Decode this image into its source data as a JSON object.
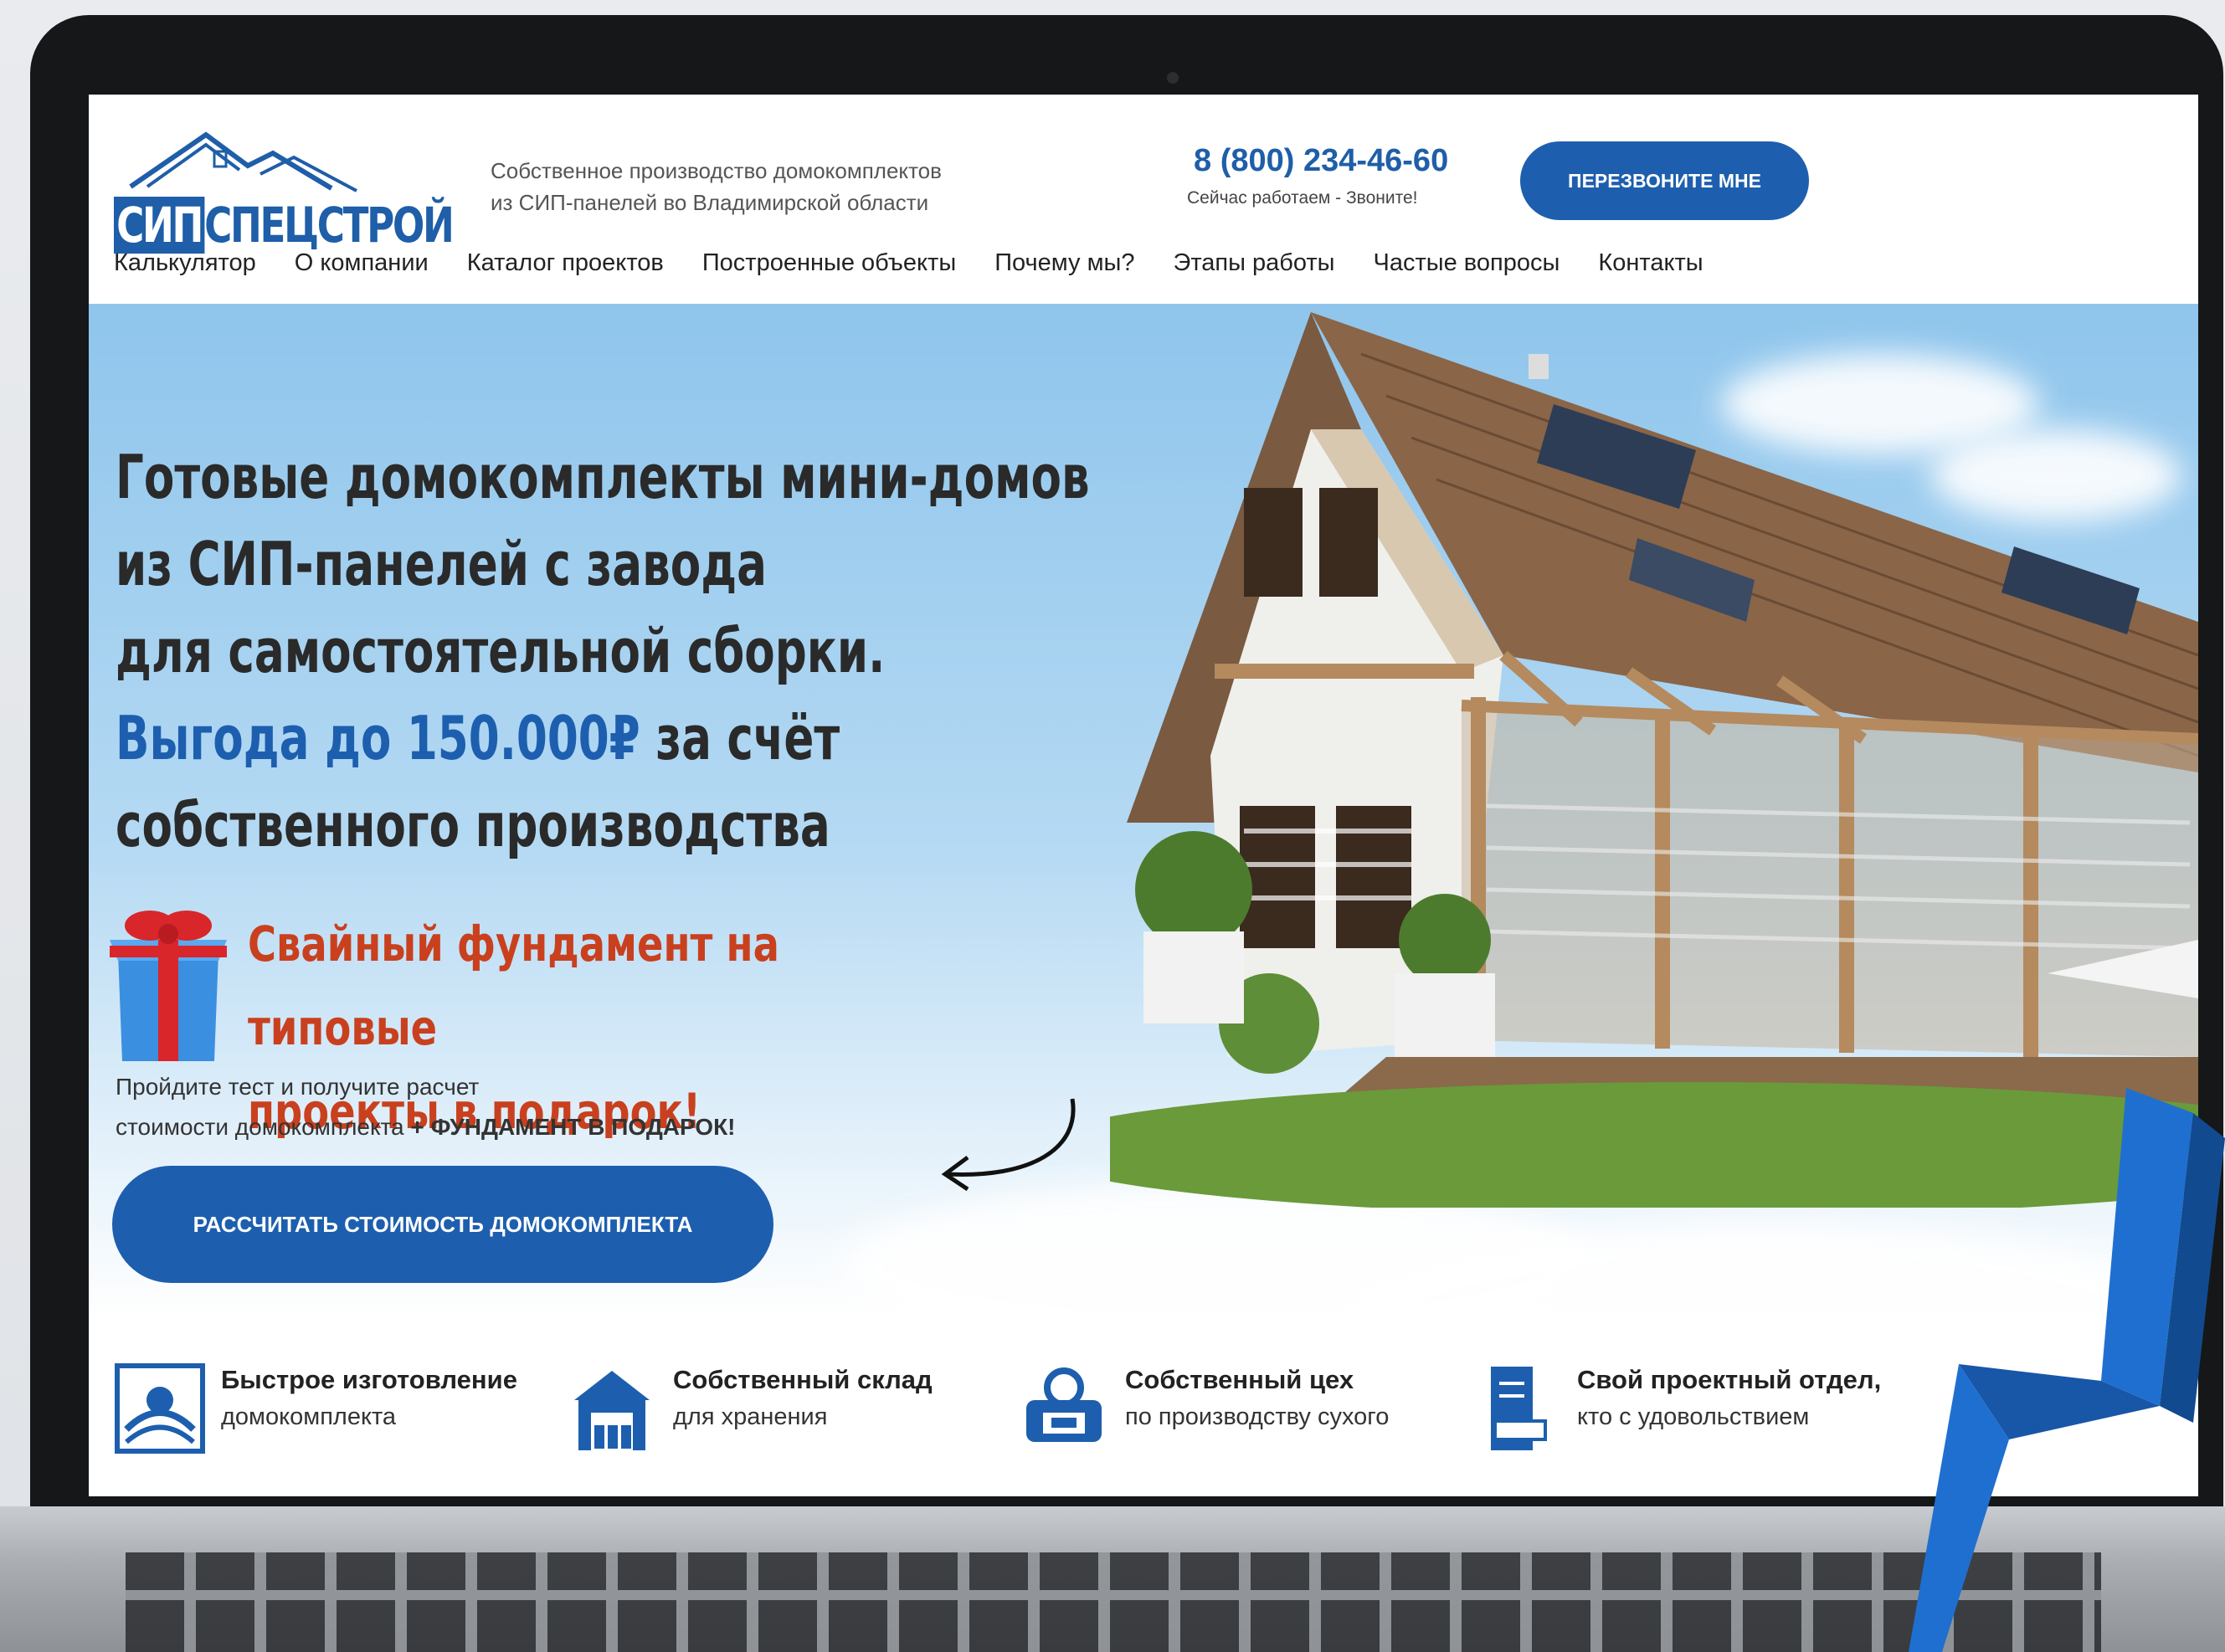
{
  "site": {
    "logo_part1": "СИП",
    "logo_part2": "СПЕЦСТРОЙ",
    "tagline_line1": "Собственное производство домокомплектов",
    "tagline_line2": "из СИП-панелей во Владимирской области",
    "phone": "8 (800) 234-46-60",
    "phone_status": "Сейчас работаем - Звоните!",
    "callback_label": "ПЕРЕЗВОНИТЕ МНЕ"
  },
  "nav": [
    "Калькулятор",
    "О компании",
    "Каталог проектов",
    "Построенные объекты",
    "Почему мы?",
    "Этапы работы",
    "Частые вопросы",
    "Контакты"
  ],
  "hero": {
    "line1": "Готовые домокомплекты мини-домов",
    "line2": "из СИП-панелей с завода",
    "line3": "для самостоятельной сборки.",
    "line4_blue": "Выгода до 150.000₽",
    "line4_rest": " за счёт",
    "line5": "собственного производства",
    "promo_line1": "Свайный фундамент на типовые",
    "promo_line2": "проекты в подарок!",
    "sub_line1": "Пройдите тест  и получите расчет",
    "sub_line2_plain": "стоимости домокомплекта ",
    "sub_line2_bold": "+ ФУНДАМЕНТ В ПОДАРОК!",
    "cta_label": "РАССЧИТАТЬ СТОИМОСТЬ ДОМОКОМПЛЕКТА"
  },
  "features": [
    {
      "title": "Быстрое изготовление",
      "desc": "домокомплекта",
      "icon": "fast-production-icon"
    },
    {
      "title": "Собственный склад",
      "desc": "для хранения",
      "icon": "warehouse-icon"
    },
    {
      "title": "Собственный цех",
      "desc": "по производству сухого",
      "icon": "workshop-icon"
    },
    {
      "title": "Свой проектный отдел,",
      "desc": "кто с удовольствием",
      "icon": "design-department-icon"
    }
  ],
  "colors": {
    "brand_blue": "#1d5fae",
    "promo_red": "#c9401e",
    "sky": "#8fc5ec"
  }
}
